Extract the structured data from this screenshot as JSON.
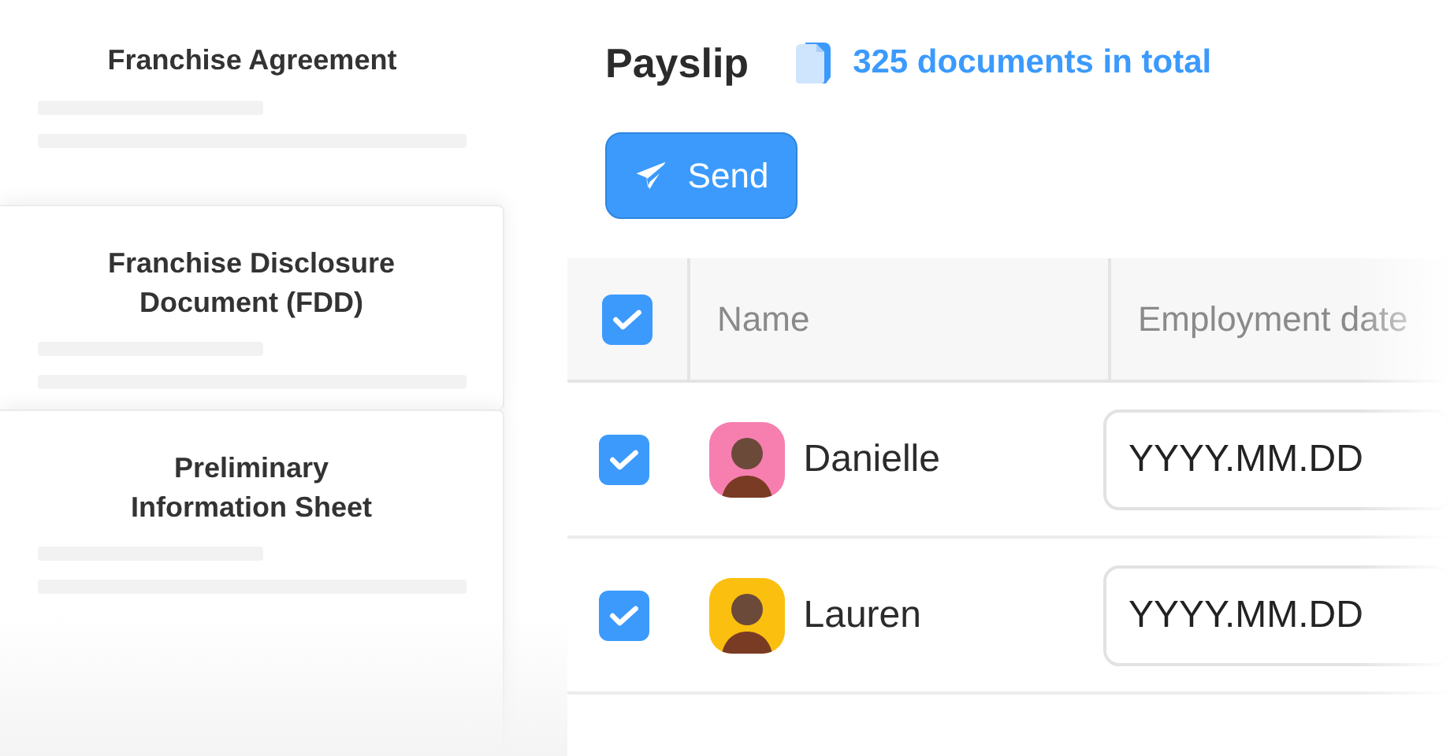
{
  "documents": [
    {
      "title": "Franchise Agreement"
    },
    {
      "title": "Franchise Disclosure Document (FDD)"
    },
    {
      "title": "Preliminary Information Sheet"
    }
  ],
  "header": {
    "title": "Payslip",
    "count": "325 documents in total"
  },
  "send_button": {
    "label": "Send"
  },
  "table": {
    "select_all": {
      "checked": true
    },
    "columns": [
      "Name",
      "Employment date"
    ],
    "rows": [
      {
        "checked": true,
        "name": "Danielle",
        "color": "#f77fb0",
        "date_placeholder": "YYYY.MM.DD"
      },
      {
        "checked": true,
        "name": "Lauren",
        "color": "#fbbf0f",
        "date_placeholder": "YYYY.MM.DD"
      }
    ]
  }
}
